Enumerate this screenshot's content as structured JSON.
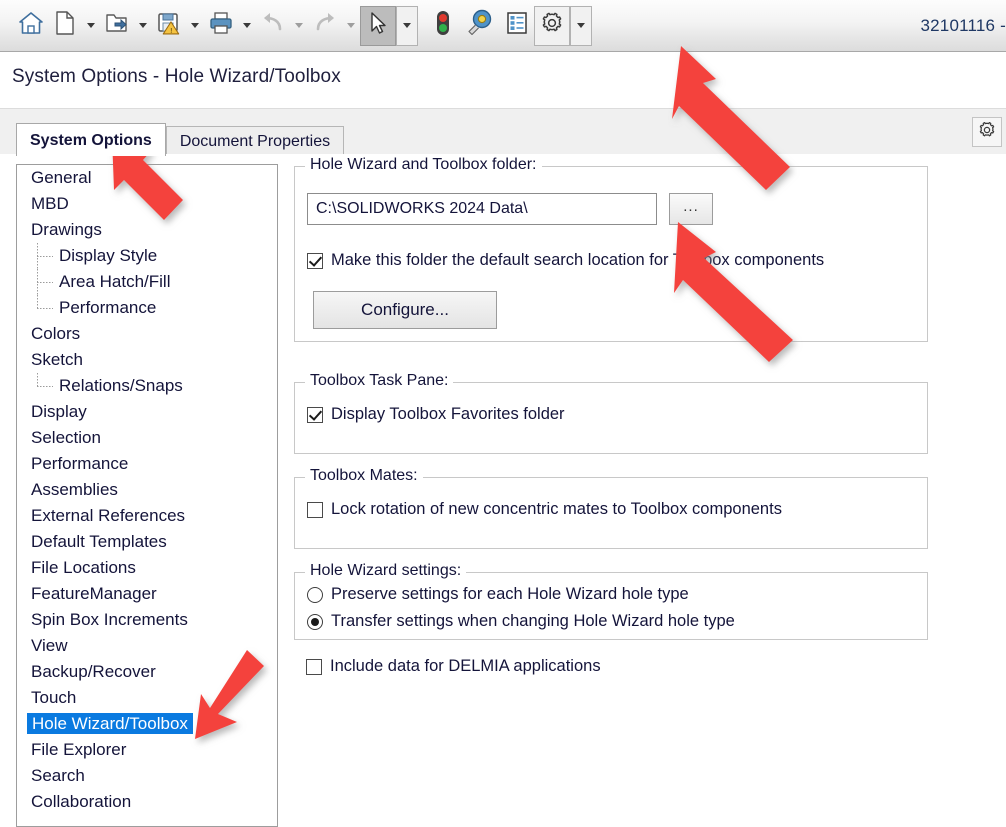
{
  "toolbar": {
    "buttons": [
      {
        "name": "home-icon",
        "label": "Home",
        "caret": false
      },
      {
        "name": "new-document-icon",
        "label": "New",
        "caret": true
      },
      {
        "name": "open-folder-icon",
        "label": "Open",
        "caret": true
      },
      {
        "name": "save-warning-icon",
        "label": "Save",
        "caret": true
      },
      {
        "name": "print-icon",
        "label": "Print",
        "caret": true
      },
      {
        "name": "undo-icon",
        "label": "Undo",
        "caret": true
      },
      {
        "name": "redo-icon",
        "label": "Redo",
        "caret": true
      },
      {
        "name": "select-cursor-icon",
        "label": "Select",
        "caret": true
      },
      {
        "name": "traffic-light-icon",
        "label": "Rebuild",
        "caret": false
      },
      {
        "name": "measure-icon",
        "label": "Measure",
        "caret": false
      },
      {
        "name": "properties-list-icon",
        "label": "File Properties",
        "caret": false
      },
      {
        "name": "options-gear-icon",
        "label": "Options",
        "caret": true
      }
    ],
    "right_text": "32101116 -"
  },
  "dialog": {
    "title": "System Options - Hole Wizard/Toolbox",
    "tabs": [
      {
        "label": "System Options",
        "active": true
      },
      {
        "label": "Document Properties",
        "active": false
      }
    ],
    "settings_gear": "gear-icon"
  },
  "sidebar": {
    "items": [
      {
        "label": "General",
        "indent": 0,
        "selected": false,
        "tree": "none"
      },
      {
        "label": "MBD",
        "indent": 0,
        "selected": false,
        "tree": "none"
      },
      {
        "label": "Drawings",
        "indent": 0,
        "selected": false,
        "tree": "none"
      },
      {
        "label": "Display Style",
        "indent": 1,
        "selected": false,
        "tree": "mid"
      },
      {
        "label": "Area Hatch/Fill",
        "indent": 1,
        "selected": false,
        "tree": "mid"
      },
      {
        "label": "Performance",
        "indent": 1,
        "selected": false,
        "tree": "last"
      },
      {
        "label": "Colors",
        "indent": 0,
        "selected": false,
        "tree": "none"
      },
      {
        "label": "Sketch",
        "indent": 0,
        "selected": false,
        "tree": "none"
      },
      {
        "label": "Relations/Snaps",
        "indent": 1,
        "selected": false,
        "tree": "last"
      },
      {
        "label": "Display",
        "indent": 0,
        "selected": false,
        "tree": "none"
      },
      {
        "label": "Selection",
        "indent": 0,
        "selected": false,
        "tree": "none"
      },
      {
        "label": "Performance",
        "indent": 0,
        "selected": false,
        "tree": "none"
      },
      {
        "label": "Assemblies",
        "indent": 0,
        "selected": false,
        "tree": "none"
      },
      {
        "label": "External References",
        "indent": 0,
        "selected": false,
        "tree": "none"
      },
      {
        "label": "Default Templates",
        "indent": 0,
        "selected": false,
        "tree": "none"
      },
      {
        "label": "File Locations",
        "indent": 0,
        "selected": false,
        "tree": "none"
      },
      {
        "label": "FeatureManager",
        "indent": 0,
        "selected": false,
        "tree": "none"
      },
      {
        "label": "Spin Box Increments",
        "indent": 0,
        "selected": false,
        "tree": "none"
      },
      {
        "label": "View",
        "indent": 0,
        "selected": false,
        "tree": "none"
      },
      {
        "label": "Backup/Recover",
        "indent": 0,
        "selected": false,
        "tree": "none"
      },
      {
        "label": "Touch",
        "indent": 0,
        "selected": false,
        "tree": "none"
      },
      {
        "label": "Hole Wizard/Toolbox",
        "indent": 0,
        "selected": true,
        "tree": "none"
      },
      {
        "label": "File Explorer",
        "indent": 0,
        "selected": false,
        "tree": "none"
      },
      {
        "label": "Search",
        "indent": 0,
        "selected": false,
        "tree": "none"
      },
      {
        "label": "Collaboration",
        "indent": 0,
        "selected": false,
        "tree": "none"
      }
    ],
    "selected_label": "Hole Wizard/Toolbox",
    "selection_color": "#0a7ae0"
  },
  "panel": {
    "folder_group": {
      "legend": "Hole Wizard and Toolbox folder:",
      "path_value": "C:\\SOLIDWORKS 2024 Data\\",
      "browse_label": "...",
      "default_search_checkbox": {
        "label": "Make this folder the default search location for Toolbox components",
        "checked": true
      },
      "configure_label": "Configure..."
    },
    "task_pane_group": {
      "legend": "Toolbox Task Pane:",
      "favorites_checkbox": {
        "label": "Display Toolbox Favorites folder",
        "checked": true
      }
    },
    "mates_group": {
      "legend": "Toolbox Mates:",
      "lock_rotation_checkbox": {
        "label": "Lock rotation of new concentric mates to Toolbox components",
        "checked": false
      }
    },
    "hole_wizard_group": {
      "legend": "Hole Wizard settings:",
      "options": [
        {
          "label": "Preserve settings for each Hole Wizard hole type",
          "selected": false
        },
        {
          "label": "Transfer settings when changing Hole Wizard hole type",
          "selected": true
        }
      ]
    },
    "delmia_checkbox": {
      "label": "Include data for DELMIA applications",
      "checked": false
    }
  },
  "annotations": {
    "arrow_color": "#F4433C",
    "arrows": [
      {
        "name": "arrow-to-options-gear",
        "target": "options-gear-icon"
      },
      {
        "name": "arrow-to-system-options-tab",
        "target": "tab-system-options"
      },
      {
        "name": "arrow-to-browse-button",
        "target": "browse-button"
      },
      {
        "name": "arrow-to-hole-wizard-toolbox-item",
        "target": "sidebar-item-hole-wizard-toolbox"
      }
    ]
  }
}
